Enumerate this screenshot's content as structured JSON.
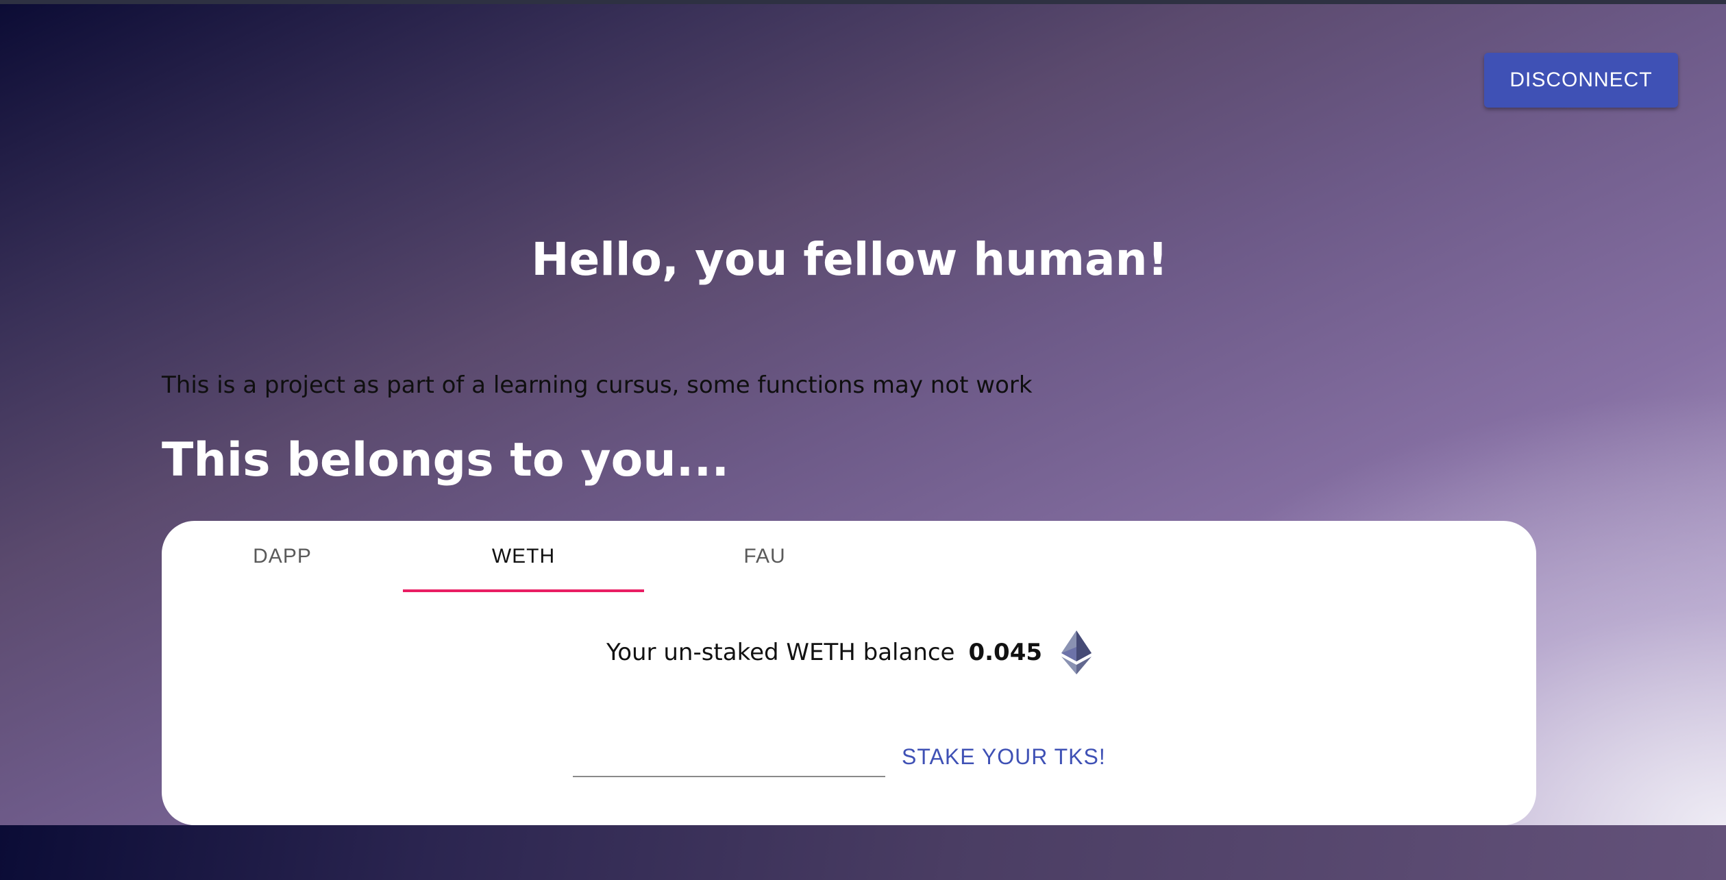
{
  "header": {
    "disconnect_label": "DISCONNECT"
  },
  "main": {
    "greeting": "Hello, you fellow human!",
    "notice": "This is a project as part of a learning cursus, some functions may not work",
    "section_title": "This belongs to you..."
  },
  "tabs": [
    {
      "label": "DAPP",
      "active": false
    },
    {
      "label": "WETH",
      "active": true
    },
    {
      "label": "FAU",
      "active": false
    }
  ],
  "wallet": {
    "balance_label": "Your un-staked WETH balance",
    "balance_value": "0.045",
    "token_icon": "ethereum-icon",
    "stake_input_value": "",
    "stake_button_label": "STAKE YOUR TKS!"
  },
  "colors": {
    "primary": "#3f51b5",
    "tab_indicator": "#e91e63"
  }
}
